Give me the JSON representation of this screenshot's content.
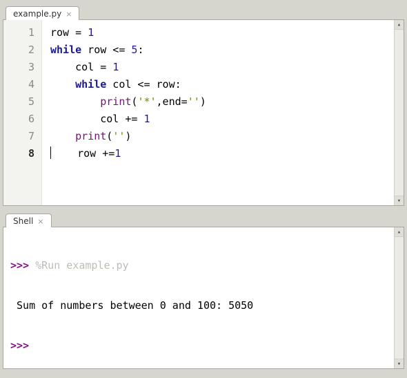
{
  "editor": {
    "tab_label": "example.py",
    "active_line": 8,
    "lines": [
      {
        "n": 1,
        "tokens": [
          [
            "",
            "row = "
          ],
          [
            "num",
            "1"
          ]
        ]
      },
      {
        "n": 2,
        "tokens": [
          [
            "kw",
            "while"
          ],
          [
            "",
            " row <= "
          ],
          [
            "num",
            "5"
          ],
          [
            "",
            ":"
          ]
        ]
      },
      {
        "n": 3,
        "tokens": [
          [
            "",
            "    col = "
          ],
          [
            "num",
            "1"
          ]
        ]
      },
      {
        "n": 4,
        "tokens": [
          [
            "",
            "    "
          ],
          [
            "kw",
            "while"
          ],
          [
            "",
            " col <= row:"
          ]
        ]
      },
      {
        "n": 5,
        "tokens": [
          [
            "",
            "        "
          ],
          [
            "builtin",
            "print"
          ],
          [
            "",
            "("
          ],
          [
            "str",
            "'*'"
          ],
          [
            "",
            ",end="
          ],
          [
            "str",
            "''"
          ],
          [
            "",
            ")"
          ]
        ]
      },
      {
        "n": 6,
        "tokens": [
          [
            "",
            "        col += "
          ],
          [
            "num",
            "1"
          ]
        ]
      },
      {
        "n": 7,
        "tokens": [
          [
            "",
            "    "
          ],
          [
            "builtin",
            "print"
          ],
          [
            "",
            "("
          ],
          [
            "str",
            "''"
          ],
          [
            "",
            ")"
          ]
        ]
      },
      {
        "n": 8,
        "tokens": [
          [
            "",
            "    row +="
          ],
          [
            "num",
            "1"
          ]
        ]
      }
    ]
  },
  "shell": {
    "tab_label": "Shell",
    "prompt": ">>>",
    "run_cmd": "%Run example.py",
    "output": " Sum of numbers between 0 and 100: 5050"
  }
}
